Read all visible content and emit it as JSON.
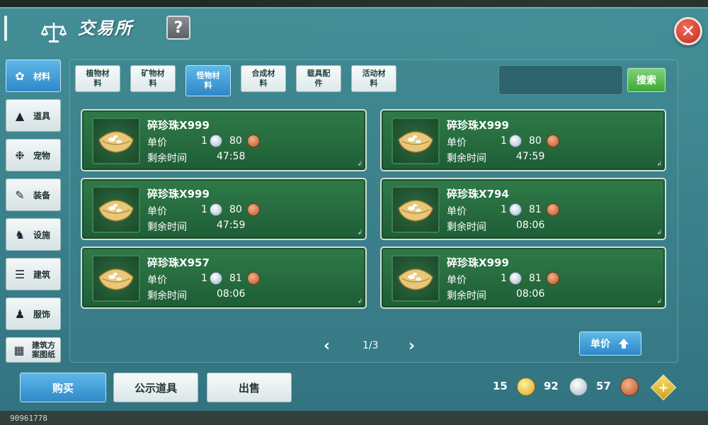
{
  "window": {
    "title": "交易所",
    "help_label": "?",
    "close_label": "✕"
  },
  "sidebar": {
    "items": [
      {
        "label": "材料",
        "icon": "materials-icon",
        "active": true
      },
      {
        "label": "道具",
        "icon": "flask-icon",
        "active": false
      },
      {
        "label": "宠物",
        "icon": "paw-icon",
        "active": false
      },
      {
        "label": "装备",
        "icon": "equipment-icon",
        "active": false
      },
      {
        "label": "设施",
        "icon": "facility-icon",
        "active": false
      },
      {
        "label": "建筑",
        "icon": "building-icon",
        "active": false
      },
      {
        "label": "服饰",
        "icon": "clothing-icon",
        "active": false
      },
      {
        "label": "建筑方案图纸",
        "icon": "blueprint-icon",
        "active": false
      }
    ]
  },
  "tabs": [
    {
      "label": "植物材料",
      "active": false
    },
    {
      "label": "矿物材料",
      "active": false
    },
    {
      "label": "怪物材料",
      "active": true
    },
    {
      "label": "合成材料",
      "active": false
    },
    {
      "label": "载具配件",
      "active": false
    },
    {
      "label": "活动材料",
      "active": false
    }
  ],
  "search": {
    "value": "",
    "button_label": "搜索"
  },
  "labels": {
    "unit_price": "单价",
    "remaining_time": "剩余时间"
  },
  "listings": [
    {
      "name": "碎珍珠X999",
      "silver": "1",
      "copper": "80",
      "time": "47:58"
    },
    {
      "name": "碎珍珠X999",
      "silver": "1",
      "copper": "80",
      "time": "47:59"
    },
    {
      "name": "碎珍珠X999",
      "silver": "1",
      "copper": "80",
      "time": "47:59"
    },
    {
      "name": "碎珍珠X794",
      "silver": "1",
      "copper": "81",
      "time": "08:06"
    },
    {
      "name": "碎珍珠X957",
      "silver": "1",
      "copper": "81",
      "time": "08:06"
    },
    {
      "name": "碎珍珠X999",
      "silver": "1",
      "copper": "81",
      "time": "08:06"
    }
  ],
  "pagination": {
    "current": 1,
    "total": 3,
    "text": "1/3",
    "prev": "‹",
    "next": "›"
  },
  "sort": {
    "label": "单价"
  },
  "actions": {
    "buy": "购买",
    "publish": "公示道具",
    "sell": "出售"
  },
  "currency": {
    "gold": "15",
    "silver": "92",
    "copper": "57",
    "add_label": "+"
  },
  "footer": {
    "player_id": "90961778"
  }
}
